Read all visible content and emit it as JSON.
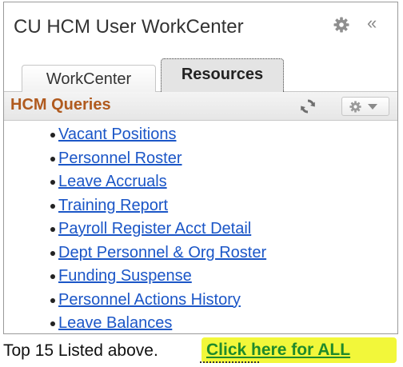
{
  "header": {
    "title": "CU HCM User WorkCenter",
    "settings_icon": "gear-icon",
    "collapse_label": "«"
  },
  "tabs": [
    {
      "label": "WorkCenter",
      "selected": false
    },
    {
      "label": "Resources",
      "selected": true
    }
  ],
  "section": {
    "title": "HCM Queries",
    "refresh_icon": "refresh-icon",
    "options_icon": "gear-dropdown-icon"
  },
  "queries": [
    {
      "label": "Vacant Positions"
    },
    {
      "label": "Personnel Roster"
    },
    {
      "label": "Leave Accruals"
    },
    {
      "label": "Training Report"
    },
    {
      "label": "Payroll Register Acct Detail"
    },
    {
      "label": "Dept Personnel & Org Roster"
    },
    {
      "label": "Funding Suspense"
    },
    {
      "label": "Personnel Actions History"
    },
    {
      "label": "Leave Balances"
    }
  ],
  "footer": {
    "text": "Top 15 Listed above.",
    "link": "Click here for ALL"
  },
  "colors": {
    "section_title": "#b05a1e",
    "link": "#1b56c7",
    "highlight": "#f2f73a",
    "all_link": "#1f8a2b"
  }
}
